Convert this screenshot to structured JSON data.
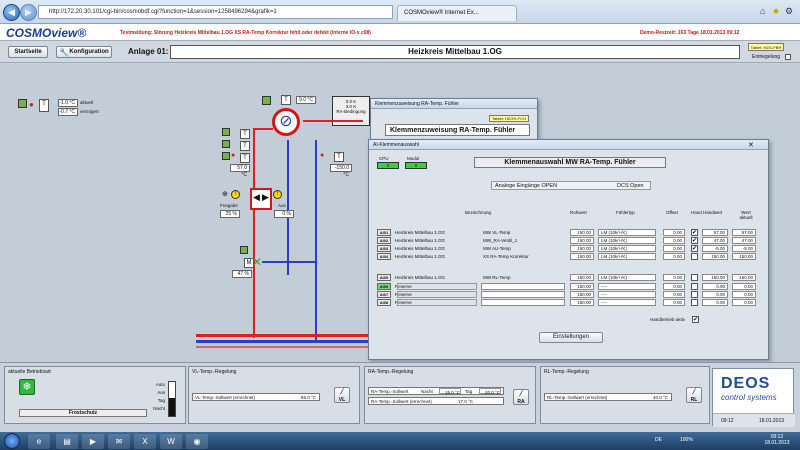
{
  "browser": {
    "url": "http://172.20.30.101/cgi-bin/cosmobdf.cgi?function=1&session=1258496294&grafik=1",
    "tab_active": "172.20.30.101",
    "tab_other": "COSMOview® Internet Ex..."
  },
  "app": {
    "logo": "COSMOview®",
    "alarm": "Testmeldung: Störung Heizkreis Mittelbau 1.OG XS RA-Temp Korrektur fehlt oder defekt (interne IO-x c08)",
    "demo": "Demo-Restzeit: 163 Tage   18.01.2013 09:12"
  },
  "toolbar": {
    "start_label": "Startseite",
    "config_label": "Konfiguration",
    "plant_label": "Anlage 01:",
    "plant_title": "Heizkreis Mittelbau 1.OG",
    "tablet_label": "Tablet: HZG-FBH",
    "entriegelung_label": "Entriegelung"
  },
  "canvas": {
    "outside_temp": "-1.0 °C",
    "outside_label": "aktuell",
    "outside_delayed": "-0.7 °C",
    "outside_delayed_label": "verzögert",
    "top_temp": "9.0 °C",
    "supply_temp": "57.0 °C",
    "room_temp": "-150.0 °C",
    "pump_left_label": "Freigabe",
    "pump_left_val": "25 %",
    "pump_right_label": "Aus",
    "pump_right_val": "0 %",
    "mixer_val": "47 %",
    "controller_line1": "0.0   K",
    "controller_line2": "3.0   K",
    "controller_line3": "RA-Bedingung"
  },
  "dialog_back": {
    "title": "Klemmenzuweisung RA-Temp. Fühler",
    "heading": "Klemmenzuweisung RA-Temp. Fühler",
    "tablet": "Tablet: HZGH-FCH"
  },
  "dialog": {
    "title": "AI-Klemmenauswahl",
    "heading": "Klemmenauswahl MW RA-Temp. Fühler",
    "cpu_label": "CPU",
    "modul_label": "Modul",
    "cpu_val": "0",
    "modul_val": "0",
    "analog_label": "Analoge Eingänge OPEN",
    "dcs_label": "DCS Open",
    "columns": {
      "bezeichnung": "Bezeichnung",
      "rohwert": "Rohwert",
      "fuehlertyp": "Fühlertyp",
      "offset": "Offset",
      "hand": "Hand",
      "handwert": "Handwert",
      "wert": "Wert aktuell"
    },
    "rows": [
      {
        "btn": "AI01",
        "name": "Heizkreis Mittelbau 1.OG",
        "desc": "MW VL-Temp",
        "raw": "150.00",
        "type": "LM (10k/+/K)",
        "offset": "0.00",
        "hand": "✔",
        "handval": "57.00",
        "value": "57.00"
      },
      {
        "btn": "AI02",
        "name": "Heizkreis Mittelbau 1.OG",
        "desc": "MW_RA-Ventil_1",
        "raw": "150.00",
        "type": "LM (10k/+/K)",
        "offset": "0.00",
        "hand": "✔",
        "handval": "47.00",
        "value": "47.00"
      },
      {
        "btn": "AI03",
        "name": "Heizkreis Mittelbau 1.OG",
        "desc": "MW AU-Temp",
        "raw": "150.00",
        "type": "LM (10k/+/K)",
        "offset": "0.00",
        "hand": "✔",
        "handval": "-5.00",
        "value": "-5.00"
      },
      {
        "btn": "AI04",
        "name": "Heizkreis Mittelbau 1.OG",
        "desc": "XS RA-Temp Korrektur",
        "raw": "150.00",
        "type": "LM (10k/+/K)",
        "offset": "0.00",
        "hand": "",
        "handval": "150.00",
        "value": "150.00"
      },
      {
        "btn": "AI05",
        "name": "Heizkreis Mittelbau 1.OG",
        "desc": "MW RL-Temp",
        "raw": "150.00",
        "type": "LM (10k/+/K)",
        "offset": "0.00",
        "hand": "",
        "handval": "150.00",
        "value": "150.00"
      },
      {
        "btn": "AI06",
        "name": "Reserve",
        "desc": "",
        "raw": "150.00",
        "type": "----",
        "offset": "0.00",
        "hand": "",
        "handval": "0.00",
        "value": "0.00"
      },
      {
        "btn": "AI07",
        "name": "Reserve",
        "desc": "",
        "raw": "150.00",
        "type": "----",
        "offset": "0.00",
        "hand": "",
        "handval": "0.00",
        "value": "0.00"
      },
      {
        "btn": "AI08",
        "name": "Reserve",
        "desc": "",
        "raw": "150.00",
        "type": "----",
        "offset": "0.00",
        "hand": "",
        "handval": "0.00",
        "value": "0.00"
      }
    ],
    "handbetrieb_label": "Handbetrieb aktiv",
    "settings_label": "Einstellungen"
  },
  "bottom": {
    "betrieb_title": "aktuelle Betriebsart",
    "betrieb_mode": "Frostschutz",
    "modes": [
      "Auto",
      "Aus",
      "Tag",
      "Nacht"
    ],
    "vl_title": "VL-Temp.-Regelung",
    "vl_label": "VL-Temp.-Sollwert (errechnet)",
    "vl_value": "55.0 °C",
    "ra_title": "RA-Temp.-Regelung",
    "ra_label1": "RA-Temp.-Sollwert",
    "ra_nacht": "Nacht",
    "ra_nacht_val": "15.0 °C",
    "ra_tag": "Tag",
    "ra_tag_val": "20.0 °C",
    "ra_label2": "RA-Temp.-Sollwert (errechnet)",
    "ra_value2": "17.0 °C",
    "rl_title": "RL-Temp.-Regelung",
    "rl_label": "RL-Temp.-Sollwert (errechnet)",
    "rl_value": "40.0 °C",
    "deos_brand": "DEOS",
    "deos_sub": "control systems",
    "deos_time": "09:12",
    "deos_date": "18.01.2013"
  },
  "taskbar": {
    "lang": "DE",
    "zoom": "100%",
    "time": "09:12",
    "date": "18.01.2013"
  }
}
